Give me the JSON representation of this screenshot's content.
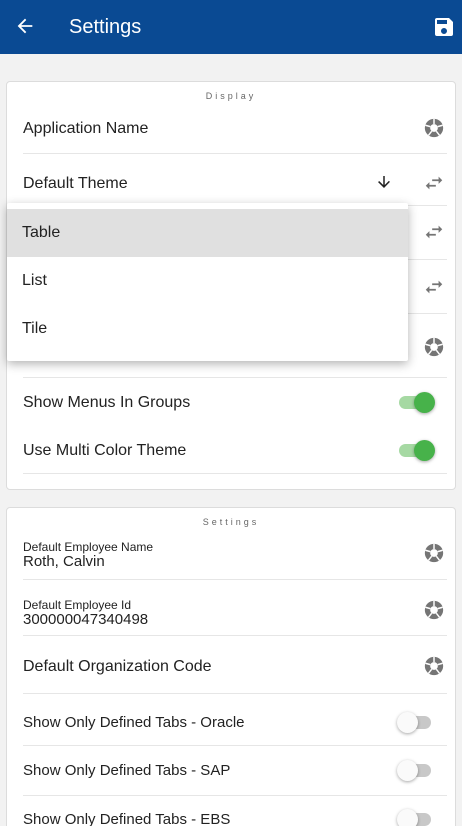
{
  "appbar": {
    "title": "Settings",
    "back_icon": "arrow-left-icon",
    "save_icon": "save-icon"
  },
  "display": {
    "section_title": "Display",
    "application_name_label": "Application Name",
    "default_theme_label": "Default Theme",
    "show_menus_in_groups_label": "Show Menus In Groups",
    "show_menus_in_groups_on": true,
    "use_multi_color_theme_label": "Use Multi Color Theme",
    "use_multi_color_theme_on": true
  },
  "theme_dropdown": {
    "options": [
      "Table",
      "List",
      "Tile"
    ],
    "selected": "Table"
  },
  "settings": {
    "section_title": "Settings",
    "employee_name_label": "Default Employee Name",
    "employee_name_value": "Roth, Calvin",
    "employee_id_label": "Default Employee Id",
    "employee_id_value": "300000047340498",
    "org_code_label": "Default Organization Code",
    "oracle_tabs_label": "Show Only Defined Tabs - Oracle",
    "oracle_tabs_on": false,
    "sap_tabs_label": "Show Only Defined Tabs - SAP",
    "sap_tabs_on": false,
    "ebs_tabs_label": "Show Only Defined Tabs - EBS",
    "ebs_tabs_on": false
  },
  "colors": {
    "appbar": "#0a4a93",
    "toggle_on": "#47b24a",
    "toggle_track_on": "#a6d9a3"
  }
}
